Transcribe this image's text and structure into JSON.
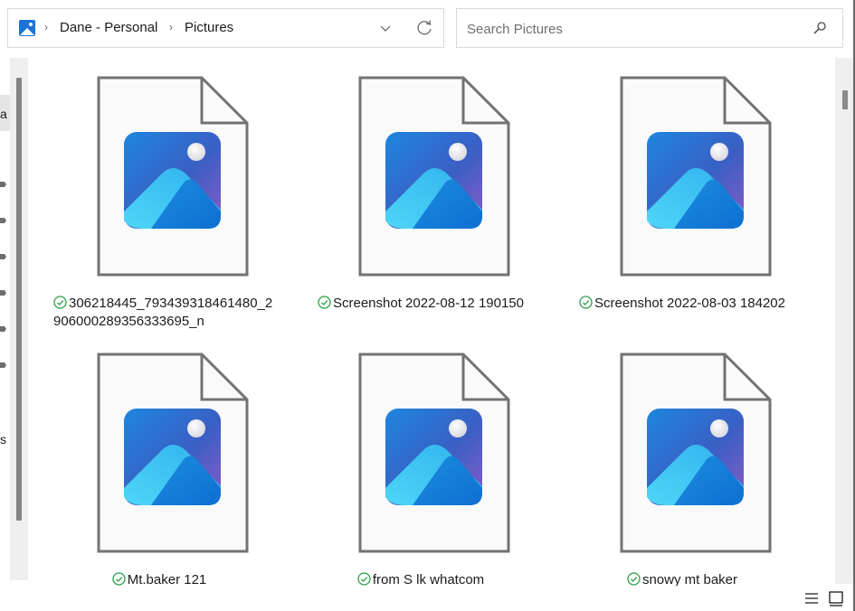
{
  "address_bar": {
    "location_icon": "pictures-folder-icon",
    "breadcrumbs": [
      "Dane - Personal",
      "Pictures"
    ],
    "dropdown_icon": "chevron-down-icon",
    "refresh_icon": "refresh-icon"
  },
  "search": {
    "placeholder": "Search Pictures",
    "value": "",
    "icon": "search-icon"
  },
  "left_pane": {
    "visible_fragments": [
      "a",
      "s"
    ],
    "pin_icons": 6
  },
  "files": [
    {
      "name_line1": "306218445_793439318461480_2",
      "name_line2": "906000289356333695_n",
      "status": "available-offline",
      "icon": "image-file-icon"
    },
    {
      "name_line1": "Screenshot 2022-08-12 190150",
      "name_line2": "",
      "status": "available-offline",
      "icon": "image-file-icon"
    },
    {
      "name_line1": "Screenshot 2022-08-03 184202",
      "name_line2": "",
      "status": "available-offline",
      "icon": "image-file-icon"
    },
    {
      "name_line1": "Mt.baker 121",
      "name_line2": "",
      "status": "available-offline",
      "icon": "image-file-icon"
    },
    {
      "name_line1": "from S lk whatcom",
      "name_line2": "",
      "status": "available-offline",
      "icon": "image-file-icon"
    },
    {
      "name_line1": "snowy mt baker",
      "name_line2": "",
      "status": "available-offline",
      "icon": "image-file-icon"
    }
  ],
  "status_bar": {
    "view_buttons": [
      "details-view",
      "large-icons-view"
    ]
  },
  "colors": {
    "status_green": "#2e9e4a",
    "doc_outline": "#737373",
    "doc_fill": "#fafafa"
  }
}
